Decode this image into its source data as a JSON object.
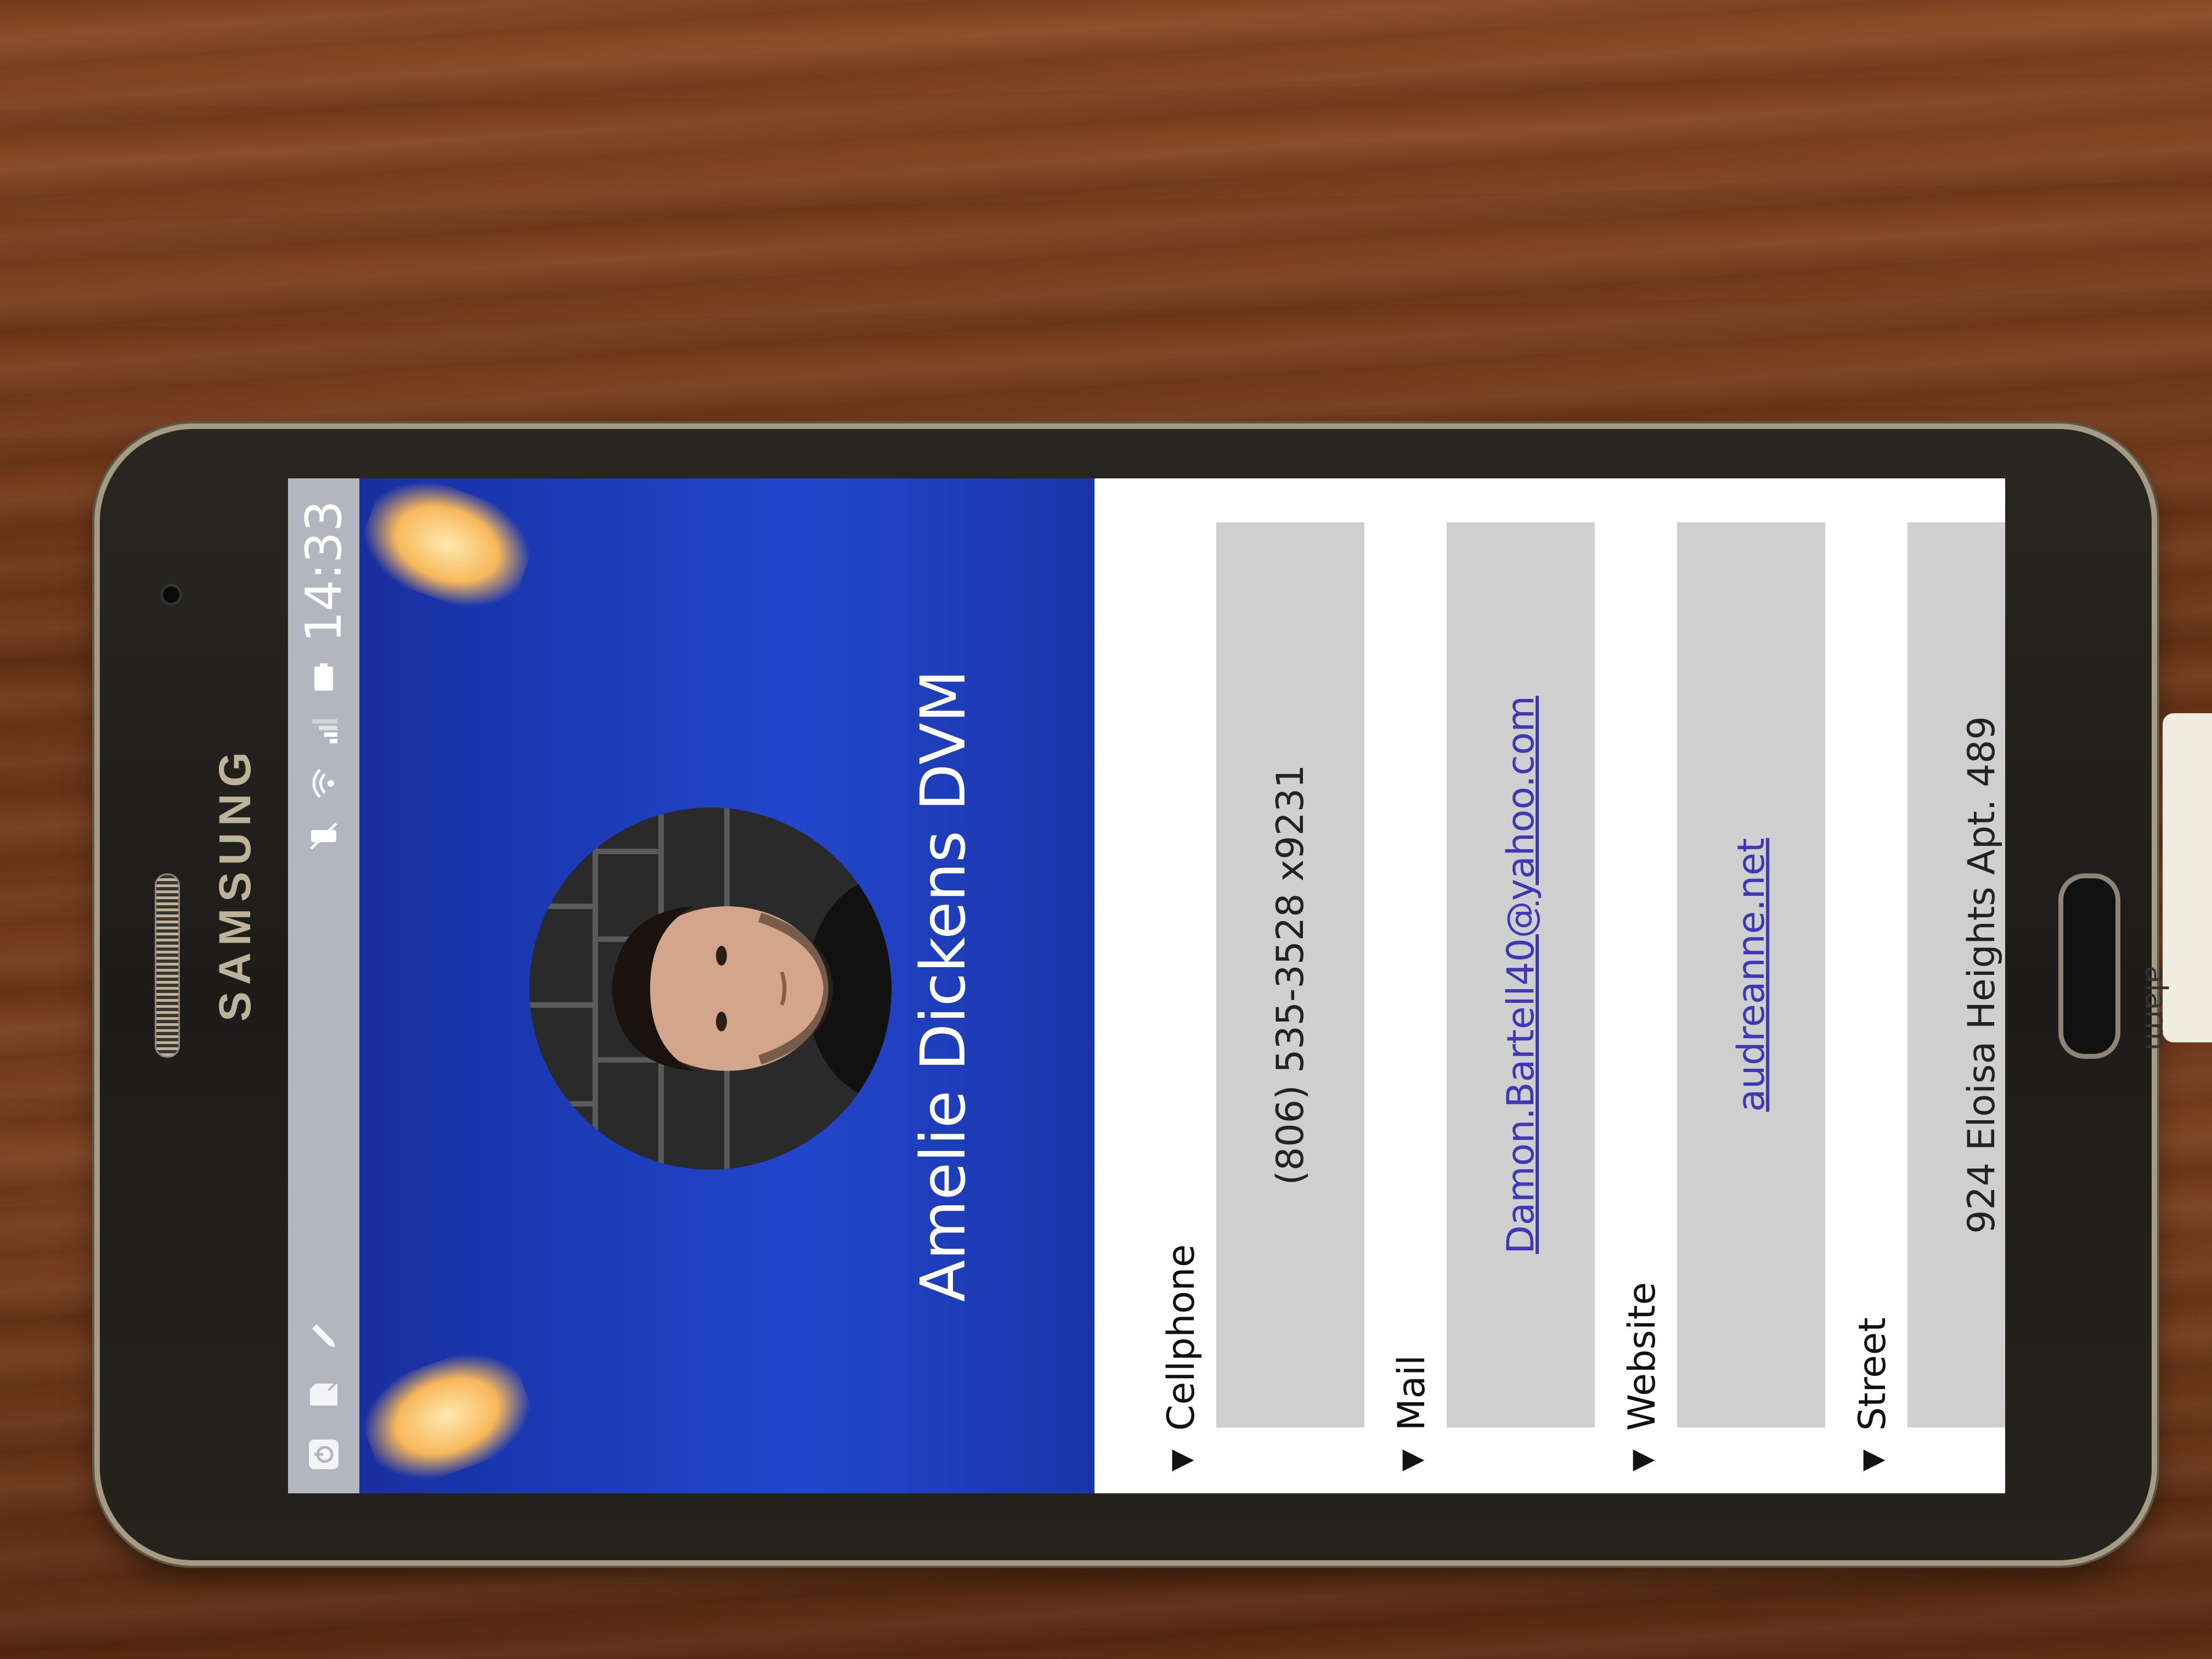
{
  "device": {
    "brand": "SAMSUNG"
  },
  "status_bar": {
    "time": "14:33",
    "icons": [
      "power-icon",
      "sim-card-icon",
      "pencil-icon",
      "vibrate-icon",
      "wifi-icon",
      "signal-icon",
      "battery-icon"
    ]
  },
  "profile": {
    "name": "Amelie Dickens DVM",
    "avatar": "profile-photo"
  },
  "fields": [
    {
      "label": "Cellphone",
      "value": "(806) 535-3528 x9231",
      "link": false
    },
    {
      "label": "Mail",
      "value": "Damon.Bartell40@yahoo.com",
      "link": true
    },
    {
      "label": "Website",
      "value": "audreanne.net",
      "link": true
    },
    {
      "label": "Street",
      "value": "924 Eloisa Heights Apt. 489",
      "link": false
    }
  ],
  "side_card": {
    "text": "alarm"
  },
  "colors": {
    "hero": "#1b3bb6",
    "link": "#3f36b8",
    "field_bg": "#cfcfcf",
    "status_bar": "#b3b6bf"
  }
}
